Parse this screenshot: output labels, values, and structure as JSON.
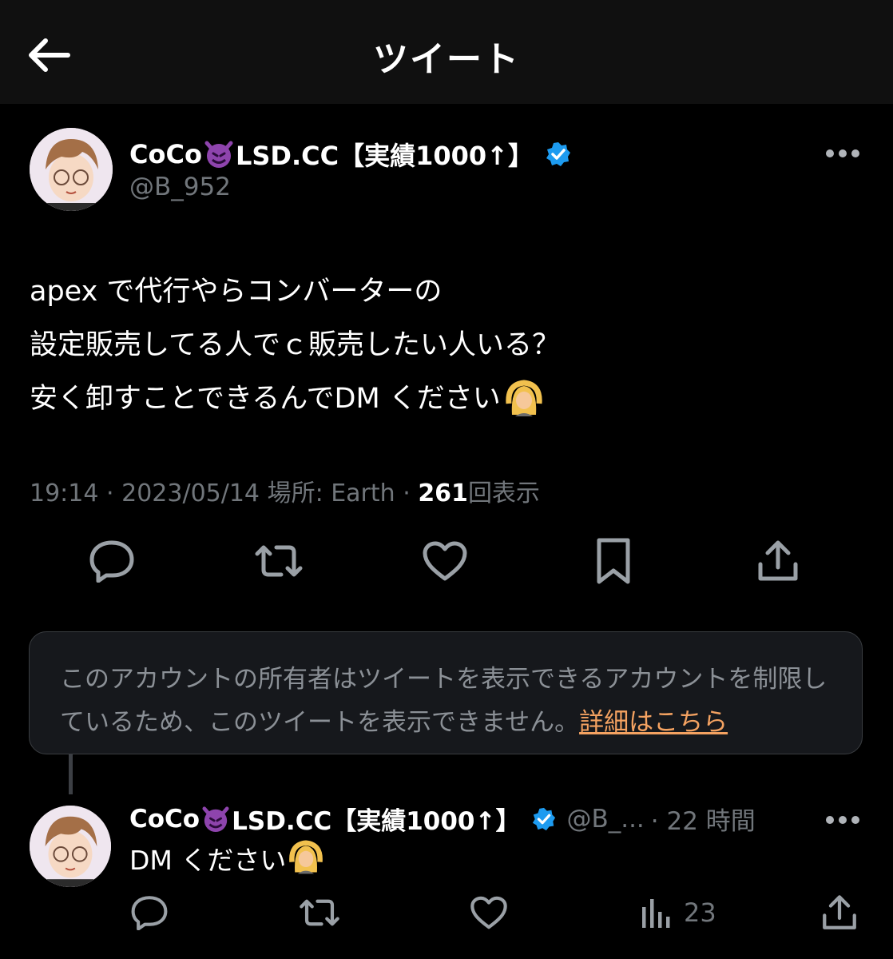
{
  "header": {
    "title": "ツイート"
  },
  "tweet": {
    "display_name": "CoCo",
    "name_suffix": "LSD.CC【実績1000↑】",
    "handle": "@B_952",
    "lines": [
      "apex で代行やらコンバーターの",
      "設定販売してる人でｃ販売したい人いる？",
      "安く卸すことできるんでDM ください"
    ],
    "time": "19:14",
    "date": "2023/05/14",
    "location_label": "場所: Earth",
    "views": "261",
    "views_label": "回表示",
    "sep": "·"
  },
  "notice": {
    "text": "このアカウントの所有者はツイートを表示できるアカウントを制限しているため、このツイートを表示できません。",
    "link": "詳細はこちら"
  },
  "reply": {
    "display_name": "CoCo",
    "name_suffix": "LSD.CC【実績1000↑】",
    "handle": "@B_...",
    "time": "· 22 時間",
    "text": "DM ください",
    "views": "23"
  },
  "colors": {
    "link": "#f4a261",
    "verified": "#1d9bf0",
    "muted": "#71767b"
  }
}
